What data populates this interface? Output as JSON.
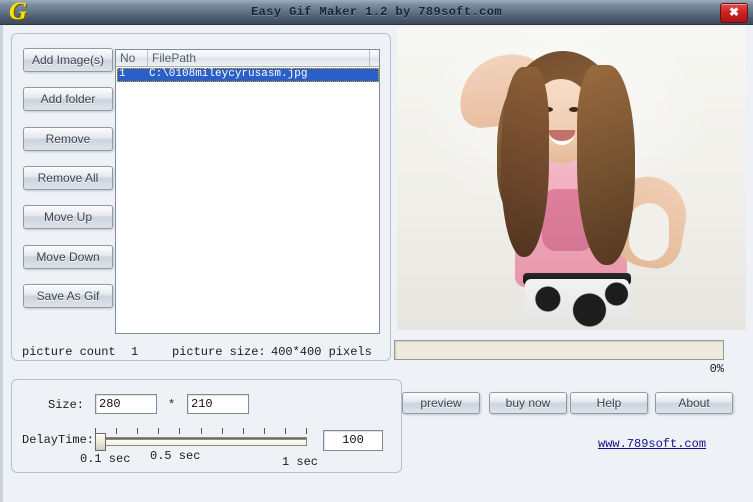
{
  "window": {
    "title": "Easy Gif Maker 1.2 by 789soft.com",
    "logo_letter": "G",
    "logo_icon": "app-logo-g",
    "close_label": "✖"
  },
  "toolbar": {
    "buttons": [
      {
        "label": "Add Image(s)",
        "name": "add-images-button"
      },
      {
        "label": "Add folder",
        "name": "add-folder-button"
      },
      {
        "label": "Remove",
        "name": "remove-button"
      },
      {
        "label": "Remove All",
        "name": "remove-all-button"
      },
      {
        "label": "Move Up",
        "name": "move-up-button"
      },
      {
        "label": "Move Down",
        "name": "move-down-button"
      },
      {
        "label": "Save As Gif",
        "name": "save-as-gif-button"
      }
    ]
  },
  "filelist": {
    "columns": [
      "No",
      "FilePath"
    ],
    "rows": [
      {
        "no": "1",
        "path": "C:\\0108mileycyrusasm.jpg",
        "selected": true
      }
    ]
  },
  "status": {
    "count_label": "picture count",
    "count_value": "1",
    "size_label": "picture size:",
    "size_value": "400*400 pixels"
  },
  "progress": {
    "percent": 0,
    "percent_text": "0%"
  },
  "settings": {
    "size_label": "Size:",
    "size_separator": "*",
    "width": "280",
    "height": "210",
    "delay_label": "DelayTime:",
    "delay_value": "100",
    "slider_min_label": "0.1 sec",
    "slider_mid_label": "0.5 sec",
    "slider_max_label": "1 sec",
    "slider_position_percent": 0,
    "slider_tick_count": 11
  },
  "actions": {
    "buttons": [
      {
        "label": "preview",
        "name": "preview-button"
      },
      {
        "label": "buy now",
        "name": "buy-now-button"
      },
      {
        "label": "Help",
        "name": "help-button"
      },
      {
        "label": "About",
        "name": "about-button"
      }
    ],
    "website": "www.789soft.com"
  },
  "preview": {
    "alt": "photo of smiling young woman in pink t-shirt, one arm raised, white background"
  }
}
